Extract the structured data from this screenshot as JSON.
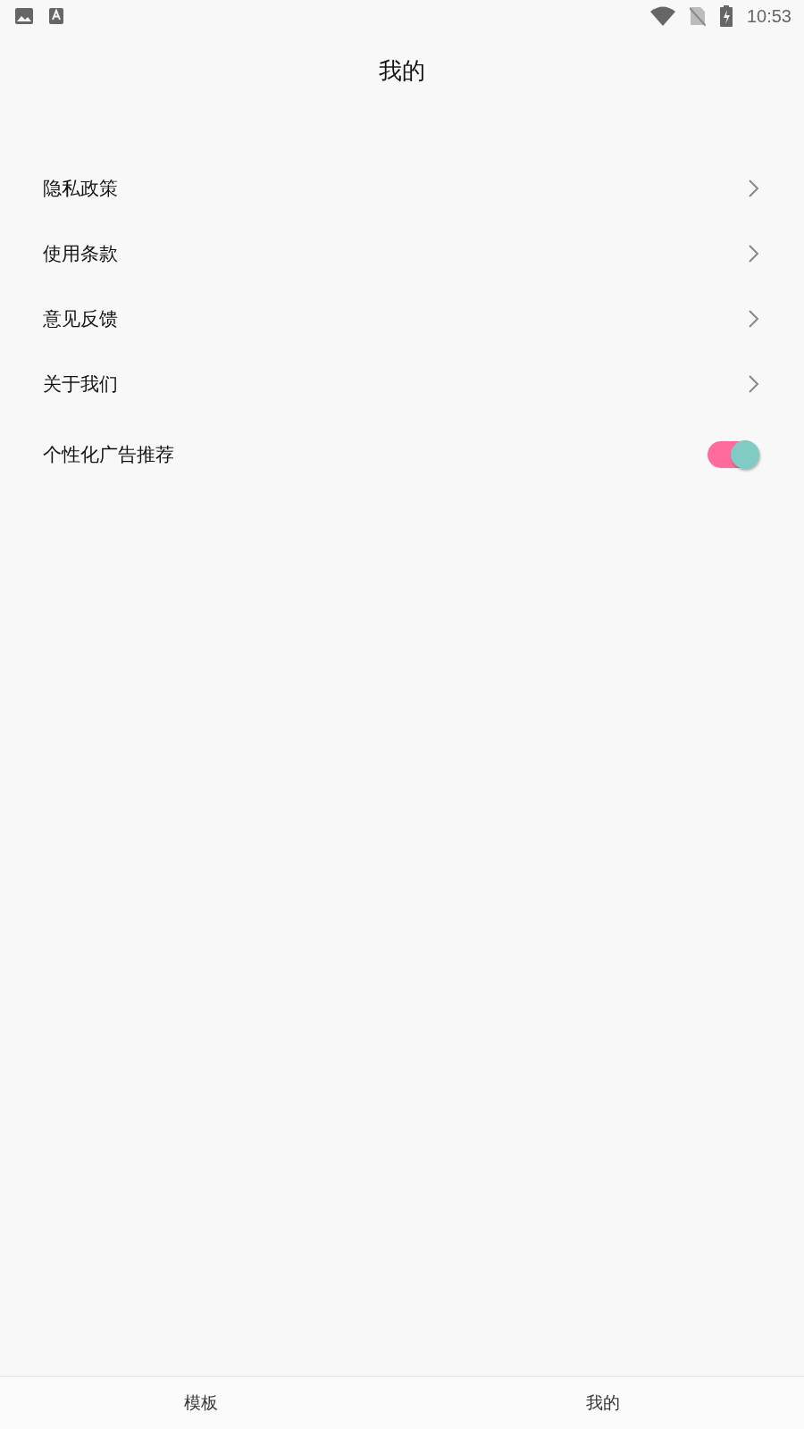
{
  "status_bar": {
    "time": "10:53"
  },
  "header": {
    "title": "我的"
  },
  "settings": [
    {
      "kind": "link",
      "label": "隐私政策"
    },
    {
      "kind": "link",
      "label": "使用条款"
    },
    {
      "kind": "link",
      "label": "意见反馈"
    },
    {
      "kind": "link",
      "label": "关于我们"
    },
    {
      "kind": "toggle",
      "label": "个性化广告推荐",
      "on": true
    }
  ],
  "bottom_nav": [
    {
      "label": "模板"
    },
    {
      "label": "我的"
    }
  ]
}
